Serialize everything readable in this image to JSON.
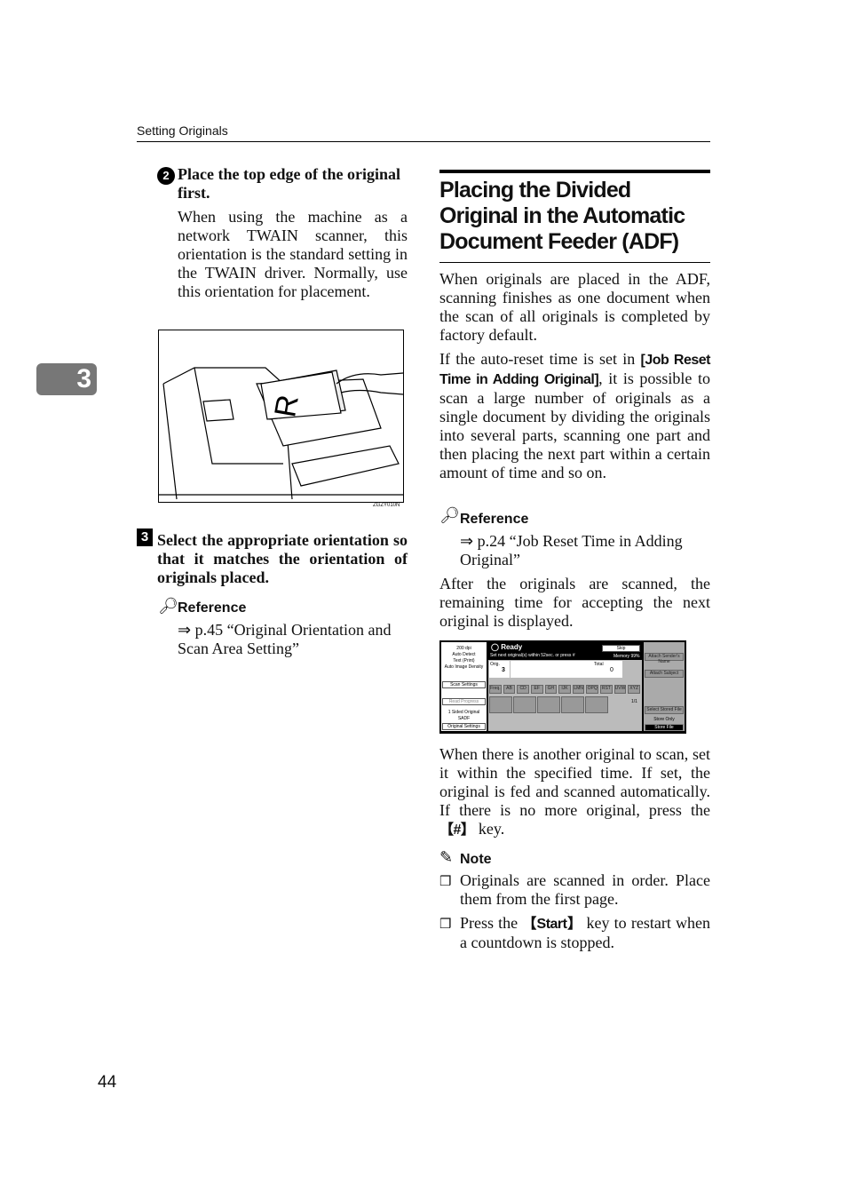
{
  "header": {
    "section": "Setting Originals"
  },
  "chapter_tab": "3",
  "page_number": "44",
  "left": {
    "step2_marker": "2",
    "step2_title": "Place the top edge of the original first.",
    "step2_body": "When using the machine as a network TWAIN scanner, this orientation is the standard setting in the TWAIN driver. Normally, use this orientation for placement.",
    "figure_code": "ZGZY010N",
    "step3_marker": "3",
    "step3_title": "Select the appropriate orientation so that it matches the orientation of originals placed.",
    "reference_label": "Reference",
    "reference_text": "⇒ p.45 “Original Orientation and Scan Area Setting”"
  },
  "right": {
    "heading": "Placing the Divided Original in the Automatic Document Feeder (ADF)",
    "para1": "When originals are placed in the ADF, scanning finishes as one document when the scan of all originals is completed by factory default.",
    "para2_pre": "If the auto-reset time is set in ",
    "para2_key": "[Job Reset Time in Adding Original]",
    "para2_post": ", it is possible to scan a large number of originals as a single document by dividing the originals into several parts, scanning one part and then placing the next part within a certain amount of time and so on.",
    "reference_label": "Reference",
    "reference_text": "⇒ p.24 “Job Reset Time in Adding Original”",
    "para3": "After the originals are scanned, the remaining time for accepting the next original is displayed.",
    "para4_pre": "When there is another original to scan, set it within the specified time. If set, the original is fed and scanned automatically. If there is no more original, press the ",
    "para4_key": "【#】",
    "para4_post": " key.",
    "note_label": "Note",
    "notes": [
      {
        "pre": "Originals are scanned in order. Place them from the first page.",
        "key": "",
        "post": ""
      },
      {
        "pre": "Press the ",
        "key": "【Start】",
        "post": " key to restart when a countdown is stopped."
      }
    ],
    "bullet": "❒"
  },
  "lcd": {
    "left_info": [
      "200 dpi",
      "Auto Detect",
      "Text (Print)",
      "Auto Image Density"
    ],
    "scan_settings": "Scan Settings",
    "read_progress": "Read Progress",
    "original_info": [
      "1 Sided Original",
      "SADF"
    ],
    "original_settings": "Original Settings",
    "status": "Ready",
    "skip": "Skip",
    "message": "Set next original(s) within 52sec. or press #",
    "memory": "Memory 99%",
    "orig_label": "Orig.",
    "orig_value": "3",
    "total_label": "Total",
    "total_value": "0",
    "tabs": [
      "Freq.",
      "AB",
      "CD",
      "EF",
      "GH",
      "IJK",
      "LMN",
      "OPQ",
      "RST",
      "UVW",
      "XYZ"
    ],
    "page": "1/1",
    "attach_sender": "Attach Sender's Name",
    "attach_subject": "Attach Subject",
    "select_stored": "Select Stored File",
    "store_only": "Store Only",
    "store_file": "Store File"
  }
}
